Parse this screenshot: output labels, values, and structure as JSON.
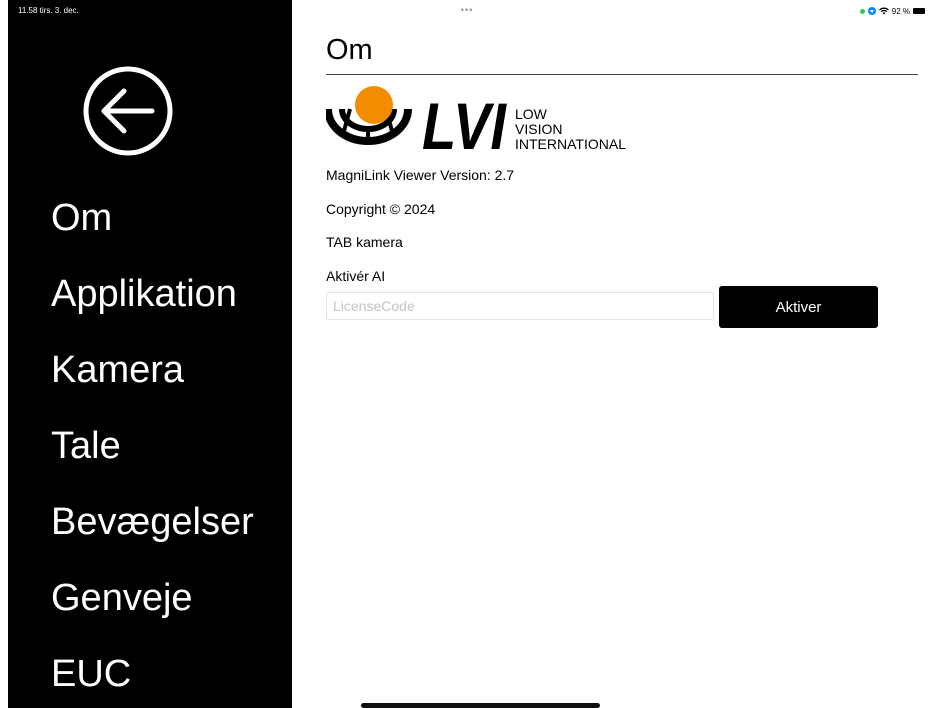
{
  "status_bar": {
    "time_date": "11.58  tirs. 3. dec.",
    "center_dots": "•••",
    "battery_percent": "92 %",
    "battery_level": 0.92,
    "icons": [
      "green-dot-indicator",
      "location-icon",
      "wifi-icon",
      "battery-icon"
    ]
  },
  "sidebar": {
    "back_icon": "back-arrow-circle-icon",
    "items": [
      {
        "label": "Om"
      },
      {
        "label": "Applikation"
      },
      {
        "label": "Kamera"
      },
      {
        "label": "Tale"
      },
      {
        "label": "Bevægelser"
      },
      {
        "label": "Genveje"
      },
      {
        "label": "EUC"
      }
    ]
  },
  "main": {
    "title": "Om",
    "logo": {
      "wordmark": "LVI",
      "line1": "LOW",
      "line2": "VISION",
      "line3": "INTERNATIONAL"
    },
    "version": "MagniLink Viewer Version: 2.7",
    "copyright": "Copyright © 2024",
    "camera": "TAB kamera",
    "ai_label": "Aktivér AI",
    "license_value": "",
    "license_placeholder": "LicenseCode",
    "activate_label": "Aktiver"
  },
  "colors": {
    "sidebar_bg": "#000000",
    "sidebar_text": "#ffffff",
    "logo_orange": "#f28c00",
    "button_bg": "#000000",
    "button_text": "#ffffff"
  }
}
